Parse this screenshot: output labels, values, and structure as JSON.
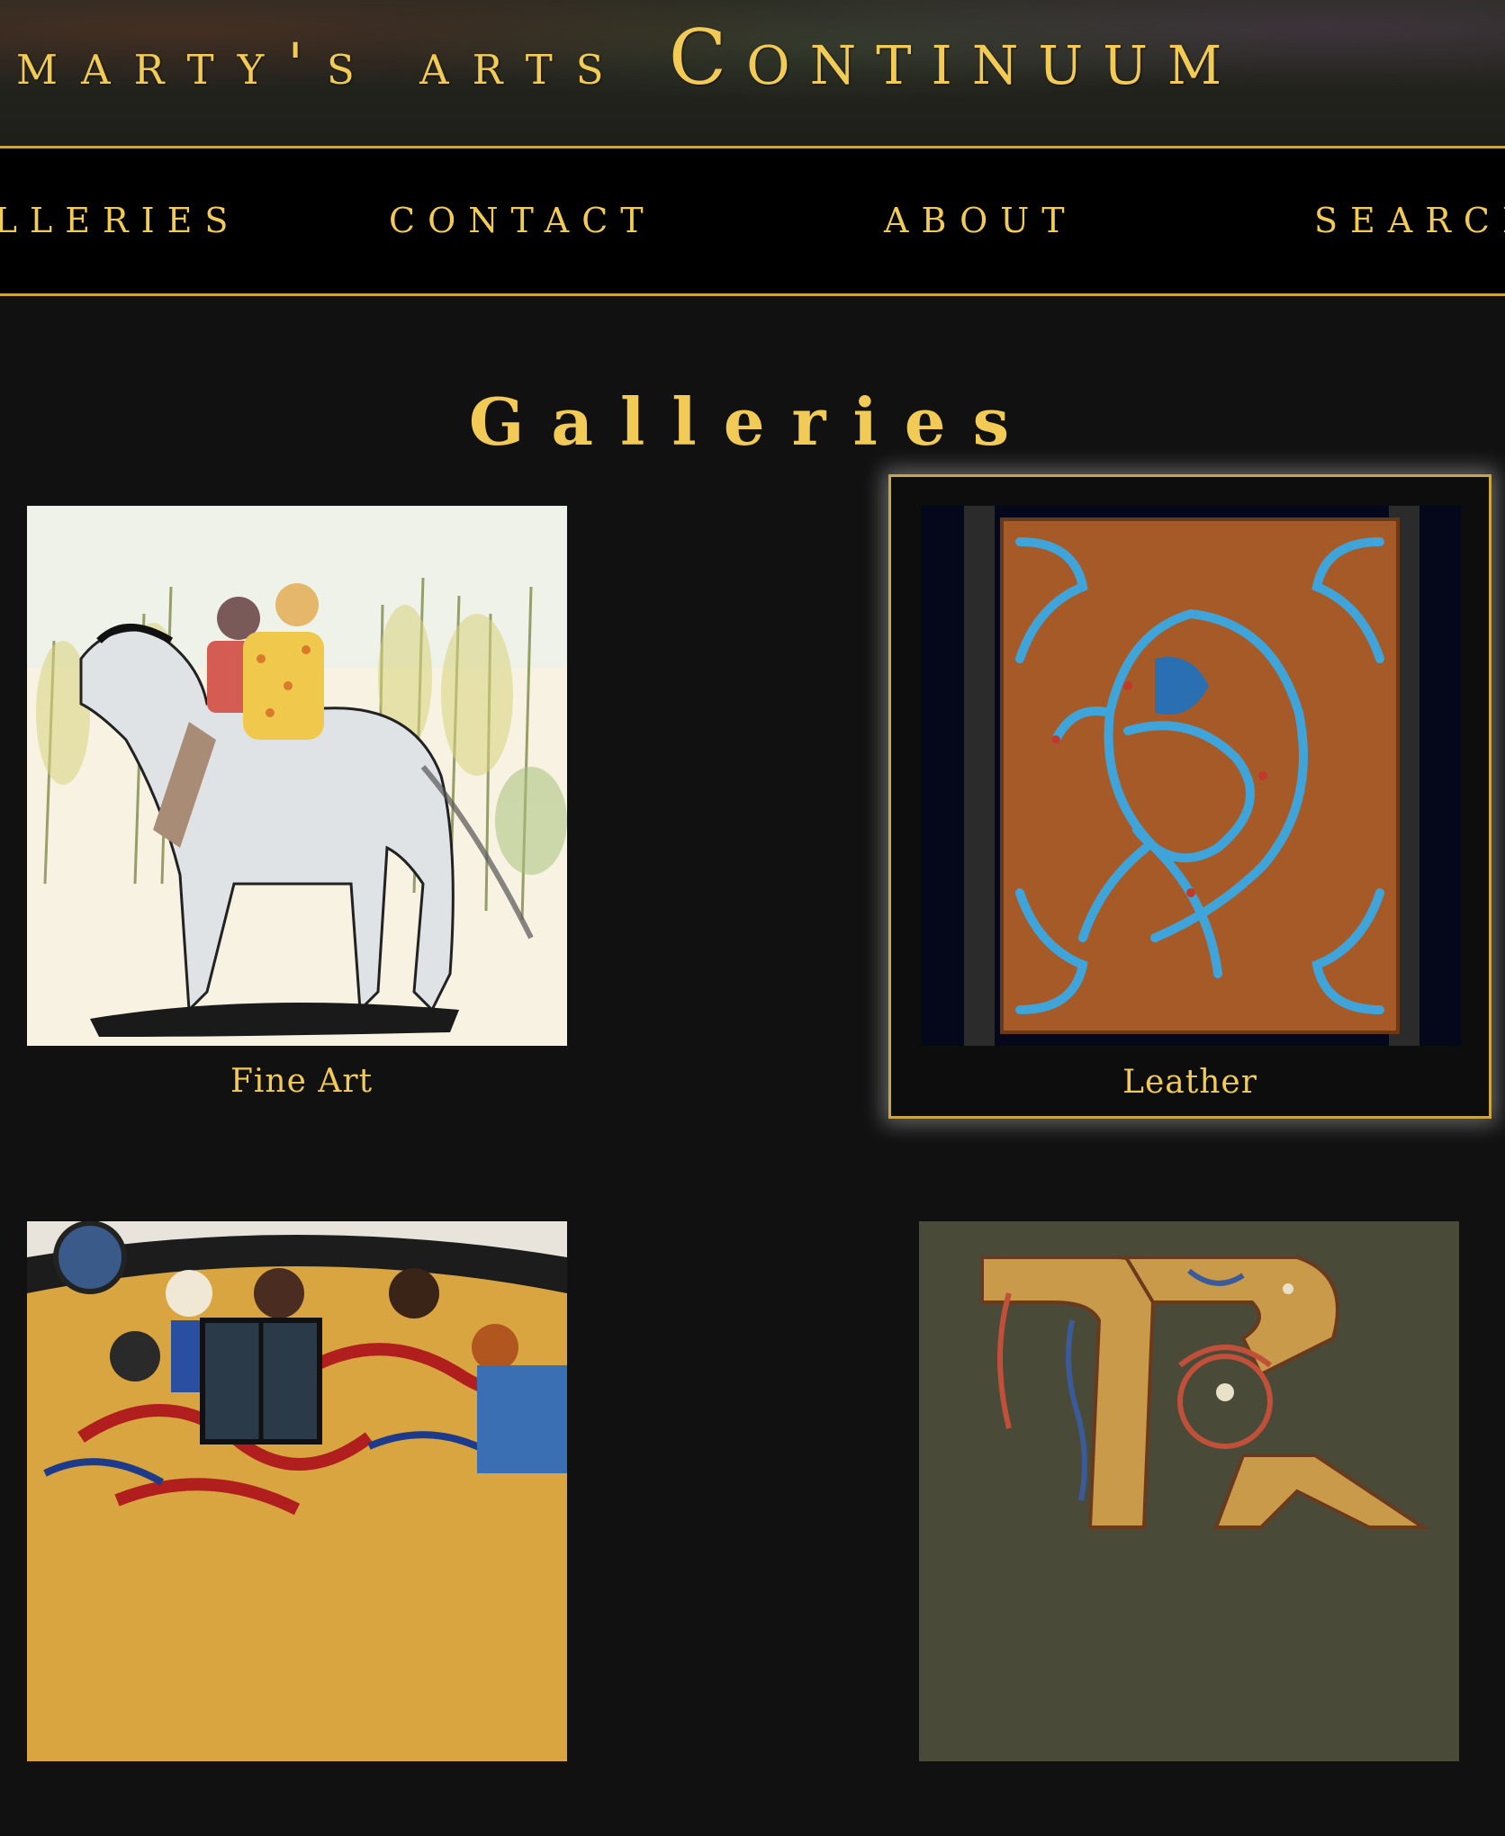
{
  "header": {
    "title_part1": "marty's arts ",
    "title_part2": "Continuum"
  },
  "nav": {
    "items": [
      {
        "label": "Galleries"
      },
      {
        "label": "Contact"
      },
      {
        "label": "About"
      },
      {
        "label": "Search"
      }
    ]
  },
  "main": {
    "heading": "Galleries",
    "galleries": [
      {
        "caption": "Fine Art",
        "thumb_icon": "watercolor-horse-riders-image"
      },
      {
        "caption": "Leather",
        "thumb_icon": "celtic-knot-horse-leather-image"
      },
      {
        "caption": "",
        "thumb_icon": "colorful-mural-image"
      },
      {
        "caption": "",
        "thumb_icon": "celtic-illuminated-letter-image"
      }
    ]
  },
  "colors": {
    "accent_gold": "#f1cb55",
    "border_gold": "#c9a640",
    "background": "#111111",
    "nav_background": "#000000"
  }
}
